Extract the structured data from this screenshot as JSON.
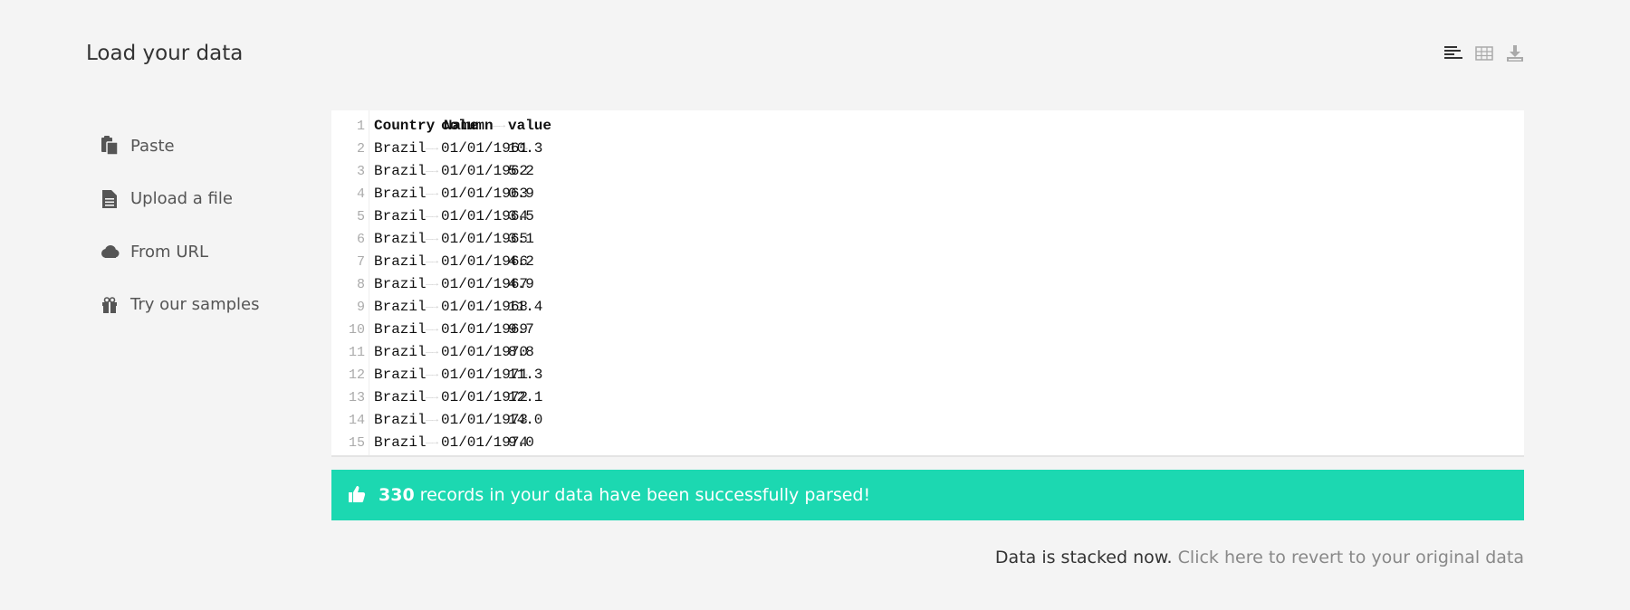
{
  "page": {
    "title": "Load your data"
  },
  "toolbar": {
    "icons": [
      "text-view-icon",
      "table-view-icon",
      "download-icon"
    ]
  },
  "sidebar": {
    "items": [
      {
        "label": "Paste",
        "icon": "paste-icon"
      },
      {
        "label": "Upload a file",
        "icon": "file-icon"
      },
      {
        "label": "From URL",
        "icon": "cloud-icon"
      },
      {
        "label": "Try our samples",
        "icon": "gift-icon"
      }
    ]
  },
  "editor": {
    "header": [
      "Country Name",
      "column",
      "value"
    ],
    "rows": [
      [
        "Brazil",
        "01/01/1961",
        "10.3"
      ],
      [
        "Brazil",
        "01/01/1962",
        "5.2"
      ],
      [
        "Brazil",
        "01/01/1963",
        "0.9"
      ],
      [
        "Brazil",
        "01/01/1964",
        "3.5"
      ],
      [
        "Brazil",
        "01/01/1965",
        "3.1"
      ],
      [
        "Brazil",
        "01/01/1966",
        "4.2"
      ],
      [
        "Brazil",
        "01/01/1967",
        "4.9"
      ],
      [
        "Brazil",
        "01/01/1968",
        "11.4"
      ],
      [
        "Brazil",
        "01/01/1969",
        "9.7"
      ],
      [
        "Brazil",
        "01/01/1970",
        "8.8"
      ],
      [
        "Brazil",
        "01/01/1971",
        "11.3"
      ],
      [
        "Brazil",
        "01/01/1972",
        "12.1"
      ],
      [
        "Brazil",
        "01/01/1973",
        "14.0"
      ],
      [
        "Brazil",
        "01/01/1974",
        "9.0"
      ]
    ]
  },
  "alert": {
    "count": "330",
    "message": "records in your data have been successfully parsed!",
    "icon": "thumbs-up-icon",
    "color": "#1cd8b1"
  },
  "footer": {
    "status": "Data is stacked now.",
    "revert_link": "Click here to revert to your original data"
  }
}
